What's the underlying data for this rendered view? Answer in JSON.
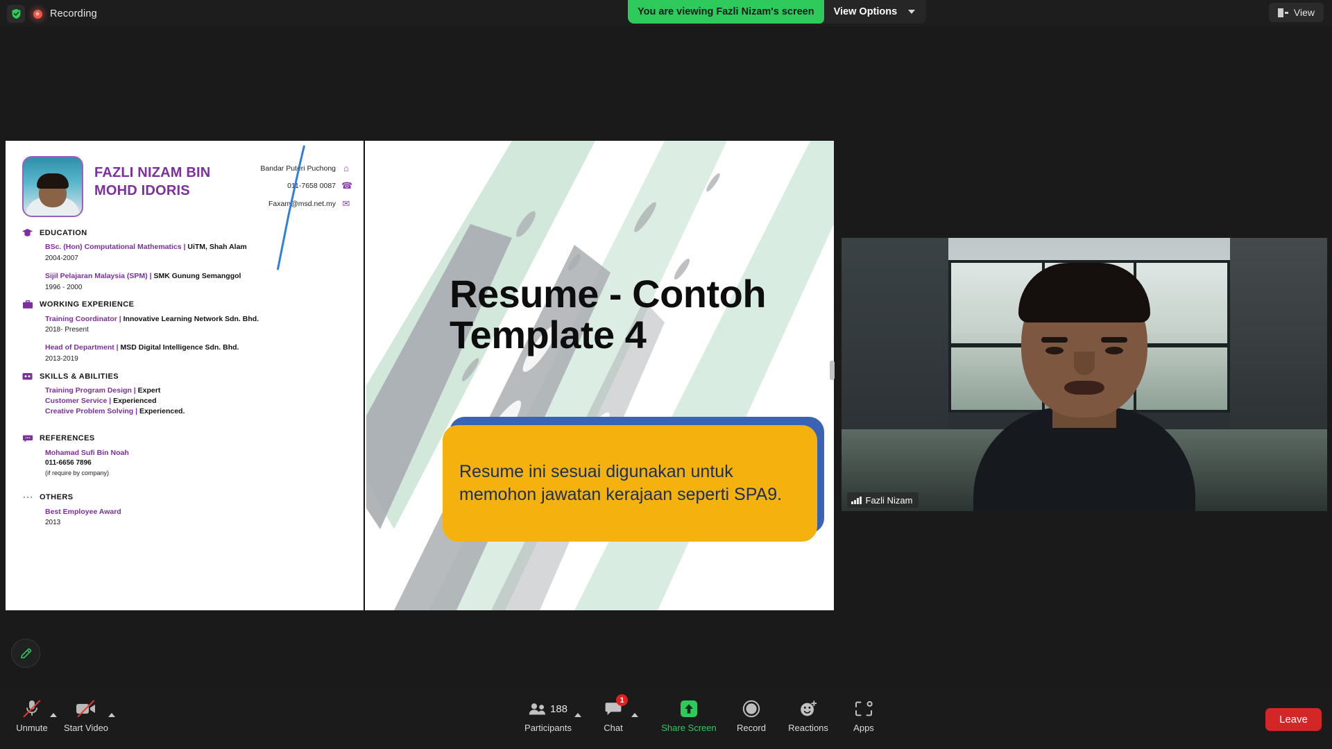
{
  "topbar": {
    "recording_label": "Recording",
    "shield_icon": "security-shield-icon",
    "recording_icon": "recording-dot-icon",
    "viewing_banner": "You are viewing Fazli Nizam's screen",
    "view_options_label": "View Options",
    "view_options_caret": "chevron-down-icon",
    "view_button_label": "View",
    "view_button_icon": "layout-view-icon"
  },
  "resume": {
    "name": "FAZLI NIZAM BIN MOHD IDORIS",
    "contacts": [
      {
        "text": "Bandar Puteri Puchong",
        "icon": "home-icon",
        "glyph": "⌂"
      },
      {
        "text": "011-7658 0087",
        "icon": "phone-icon",
        "glyph": "☎"
      },
      {
        "text": "Faxam@msd.net.my",
        "icon": "mail-icon",
        "glyph": "✉"
      }
    ],
    "sections": [
      {
        "title": "EDUCATION",
        "icon": "graduation-cap-icon",
        "glyph": "⌂",
        "entries": [
          {
            "role": "BSc. (Hon) Computational Mathematics",
            "org": "UiTM, Shah Alam",
            "dates": "2004-2007"
          },
          {
            "role": "Sijil Pelajaran Malaysia (SPM)",
            "org": "SMK Gunung Semanggol",
            "dates": "1996 - 2000"
          }
        ]
      },
      {
        "title": "WORKING EXPERIENCE",
        "icon": "briefcase-icon",
        "glyph": "▬",
        "entries": [
          {
            "role": "Training Coordinator",
            "org": "Innovative Learning Network Sdn. Bhd.",
            "dates": "2018- Present"
          },
          {
            "role": "Head of Department",
            "org": "MSD Digital Intelligence Sdn. Bhd.",
            "dates": "2013-2019"
          }
        ]
      }
    ],
    "skills_section": {
      "title": "SKILLS & ABILITIES",
      "icon": "skills-icon",
      "items": [
        {
          "name": "Training Program Design",
          "level": "Expert"
        },
        {
          "name": "Customer Service",
          "level": "Experienced"
        },
        {
          "name": "Creative Problem Solving",
          "level": "Experienced."
        }
      ]
    },
    "references_section": {
      "title": "REFERENCES",
      "icon": "speech-bubble-icon",
      "name": "Mohamad Sufi Bin Noah",
      "phone": "011-6656 7896",
      "note": "(if require by company)"
    },
    "others_section": {
      "title": "OTHERS",
      "icon": "ellipsis-icon",
      "award": "Best Employee Award",
      "year": "2013"
    }
  },
  "slide": {
    "title_line1": "Resume - Contoh",
    "title_line2": "Template 4",
    "callout_text": "Resume ini sesuai digunakan untuk memohon jawatan kerajaan seperti SPA9.",
    "callout_fill": "#f5b10d",
    "callout_shadow": "#3b63b5",
    "brush_gray": "#a9adb1",
    "brush_mint": "#cfe7d9"
  },
  "video": {
    "participant_name": "Fazli Nizam",
    "signal_icon": "signal-bars-icon"
  },
  "annotate": {
    "icon": "pencil-icon",
    "color": "#2ecb5c"
  },
  "toolbar": {
    "items": [
      {
        "label": "Unmute",
        "icon": "microphone-muted-icon",
        "caret": true,
        "badge": null,
        "count": null
      },
      {
        "label": "Start Video",
        "icon": "video-camera-off-icon",
        "caret": true,
        "badge": null,
        "count": null
      },
      {
        "label": "Participants",
        "icon": "participants-icon",
        "caret": true,
        "badge": null,
        "count": "188"
      },
      {
        "label": "Chat",
        "icon": "chat-bubble-icon",
        "caret": true,
        "badge": "1",
        "count": null
      },
      {
        "label": "Share Screen",
        "icon": "share-screen-up-arrow-icon",
        "caret": false,
        "badge": null,
        "count": null
      },
      {
        "label": "Record",
        "icon": "record-circle-icon",
        "caret": false,
        "badge": null,
        "count": null
      },
      {
        "label": "Reactions",
        "icon": "reactions-smiley-icon",
        "caret": false,
        "badge": null,
        "count": null
      },
      {
        "label": "Apps",
        "icon": "apps-frame-icon",
        "caret": false,
        "badge": null,
        "count": null
      }
    ],
    "leave_label": "Leave",
    "share_accent": "#2ecb5c",
    "leave_color": "#d32626"
  }
}
